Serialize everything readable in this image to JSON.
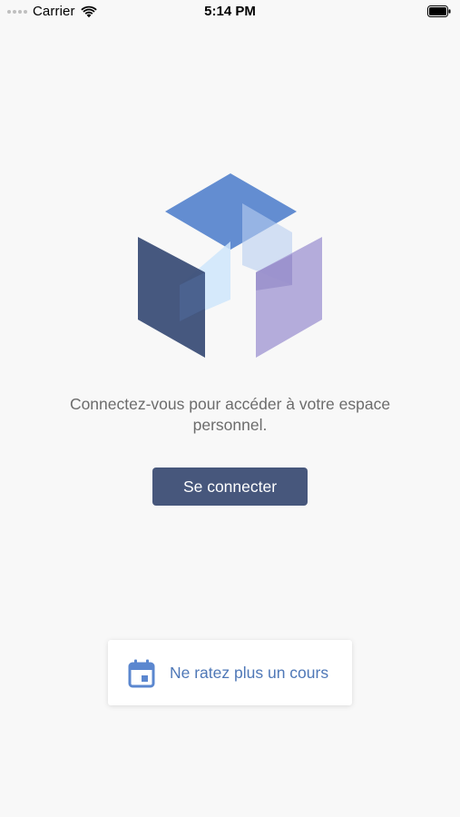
{
  "status_bar": {
    "carrier": "Carrier",
    "time": "5:14 PM",
    "wifi_icon": "wifi-icon",
    "battery_icon": "battery-icon"
  },
  "logo": {
    "icon": "cube-logo-icon",
    "colors": {
      "top": "#5b87cf",
      "left": "#3c4f78",
      "right": "#a89fd6",
      "inner": "#cfe6fb"
    }
  },
  "main": {
    "message": "Connectez-vous pour accéder à votre espace personnel.",
    "connect_label": "Se connecter"
  },
  "reminder": {
    "icon": "calendar-icon",
    "label": "Ne ratez plus un cours"
  },
  "colors": {
    "background": "#f8f8f8",
    "button": "#47577c",
    "accent": "#4f78b7",
    "text_muted": "#6c6c6c"
  }
}
